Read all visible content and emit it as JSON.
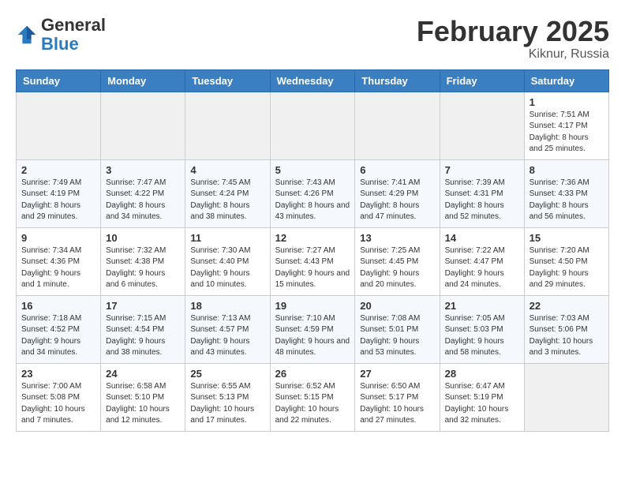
{
  "logo": {
    "general": "General",
    "blue": "Blue"
  },
  "title": "February 2025",
  "location": "Kiknur, Russia",
  "weekdays": [
    "Sunday",
    "Monday",
    "Tuesday",
    "Wednesday",
    "Thursday",
    "Friday",
    "Saturday"
  ],
  "weeks": [
    [
      {
        "day": "",
        "info": ""
      },
      {
        "day": "",
        "info": ""
      },
      {
        "day": "",
        "info": ""
      },
      {
        "day": "",
        "info": ""
      },
      {
        "day": "",
        "info": ""
      },
      {
        "day": "",
        "info": ""
      },
      {
        "day": "1",
        "info": "Sunrise: 7:51 AM\nSunset: 4:17 PM\nDaylight: 8 hours and 25 minutes."
      }
    ],
    [
      {
        "day": "2",
        "info": "Sunrise: 7:49 AM\nSunset: 4:19 PM\nDaylight: 8 hours and 29 minutes."
      },
      {
        "day": "3",
        "info": "Sunrise: 7:47 AM\nSunset: 4:22 PM\nDaylight: 8 hours and 34 minutes."
      },
      {
        "day": "4",
        "info": "Sunrise: 7:45 AM\nSunset: 4:24 PM\nDaylight: 8 hours and 38 minutes."
      },
      {
        "day": "5",
        "info": "Sunrise: 7:43 AM\nSunset: 4:26 PM\nDaylight: 8 hours and 43 minutes."
      },
      {
        "day": "6",
        "info": "Sunrise: 7:41 AM\nSunset: 4:29 PM\nDaylight: 8 hours and 47 minutes."
      },
      {
        "day": "7",
        "info": "Sunrise: 7:39 AM\nSunset: 4:31 PM\nDaylight: 8 hours and 52 minutes."
      },
      {
        "day": "8",
        "info": "Sunrise: 7:36 AM\nSunset: 4:33 PM\nDaylight: 8 hours and 56 minutes."
      }
    ],
    [
      {
        "day": "9",
        "info": "Sunrise: 7:34 AM\nSunset: 4:36 PM\nDaylight: 9 hours and 1 minute."
      },
      {
        "day": "10",
        "info": "Sunrise: 7:32 AM\nSunset: 4:38 PM\nDaylight: 9 hours and 6 minutes."
      },
      {
        "day": "11",
        "info": "Sunrise: 7:30 AM\nSunset: 4:40 PM\nDaylight: 9 hours and 10 minutes."
      },
      {
        "day": "12",
        "info": "Sunrise: 7:27 AM\nSunset: 4:43 PM\nDaylight: 9 hours and 15 minutes."
      },
      {
        "day": "13",
        "info": "Sunrise: 7:25 AM\nSunset: 4:45 PM\nDaylight: 9 hours and 20 minutes."
      },
      {
        "day": "14",
        "info": "Sunrise: 7:22 AM\nSunset: 4:47 PM\nDaylight: 9 hours and 24 minutes."
      },
      {
        "day": "15",
        "info": "Sunrise: 7:20 AM\nSunset: 4:50 PM\nDaylight: 9 hours and 29 minutes."
      }
    ],
    [
      {
        "day": "16",
        "info": "Sunrise: 7:18 AM\nSunset: 4:52 PM\nDaylight: 9 hours and 34 minutes."
      },
      {
        "day": "17",
        "info": "Sunrise: 7:15 AM\nSunset: 4:54 PM\nDaylight: 9 hours and 38 minutes."
      },
      {
        "day": "18",
        "info": "Sunrise: 7:13 AM\nSunset: 4:57 PM\nDaylight: 9 hours and 43 minutes."
      },
      {
        "day": "19",
        "info": "Sunrise: 7:10 AM\nSunset: 4:59 PM\nDaylight: 9 hours and 48 minutes."
      },
      {
        "day": "20",
        "info": "Sunrise: 7:08 AM\nSunset: 5:01 PM\nDaylight: 9 hours and 53 minutes."
      },
      {
        "day": "21",
        "info": "Sunrise: 7:05 AM\nSunset: 5:03 PM\nDaylight: 9 hours and 58 minutes."
      },
      {
        "day": "22",
        "info": "Sunrise: 7:03 AM\nSunset: 5:06 PM\nDaylight: 10 hours and 3 minutes."
      }
    ],
    [
      {
        "day": "23",
        "info": "Sunrise: 7:00 AM\nSunset: 5:08 PM\nDaylight: 10 hours and 7 minutes."
      },
      {
        "day": "24",
        "info": "Sunrise: 6:58 AM\nSunset: 5:10 PM\nDaylight: 10 hours and 12 minutes."
      },
      {
        "day": "25",
        "info": "Sunrise: 6:55 AM\nSunset: 5:13 PM\nDaylight: 10 hours and 17 minutes."
      },
      {
        "day": "26",
        "info": "Sunrise: 6:52 AM\nSunset: 5:15 PM\nDaylight: 10 hours and 22 minutes."
      },
      {
        "day": "27",
        "info": "Sunrise: 6:50 AM\nSunset: 5:17 PM\nDaylight: 10 hours and 27 minutes."
      },
      {
        "day": "28",
        "info": "Sunrise: 6:47 AM\nSunset: 5:19 PM\nDaylight: 10 hours and 32 minutes."
      },
      {
        "day": "",
        "info": ""
      }
    ]
  ]
}
